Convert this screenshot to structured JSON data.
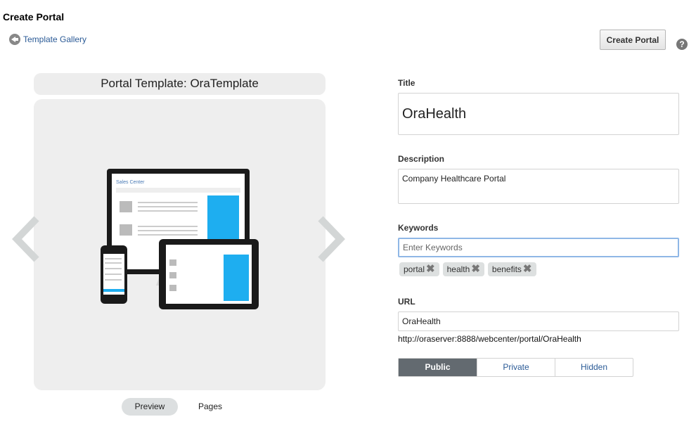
{
  "page": {
    "title": "Create Portal"
  },
  "nav": {
    "back_label": "Template Gallery",
    "create_label": "Create Portal",
    "help": "?"
  },
  "template": {
    "heading": "Portal Template: OraTemplate",
    "tabs": [
      {
        "label": "Preview",
        "selected": true
      },
      {
        "label": "Pages",
        "selected": false
      }
    ],
    "image_text": "Sales Center"
  },
  "form": {
    "title_label": "Title",
    "title_value": "OraHealth",
    "description_label": "Description",
    "description_value": "Company Healthcare Portal",
    "keywords_label": "Keywords",
    "keywords_placeholder": "Enter Keywords",
    "keywords": [
      "portal",
      "health",
      "benefits"
    ],
    "url_label": "URL",
    "url_value": "OraHealth",
    "url_full": "http://oraserver:8888/webcenter/portal/OraHealth",
    "visibility": [
      {
        "label": "Public",
        "selected": true
      },
      {
        "label": "Private",
        "selected": false
      },
      {
        "label": "Hidden",
        "selected": false
      }
    ]
  },
  "colors": {
    "accent": "#2a5a96",
    "selected_segment": "#636a70",
    "focus_border": "#8fb7e6"
  }
}
